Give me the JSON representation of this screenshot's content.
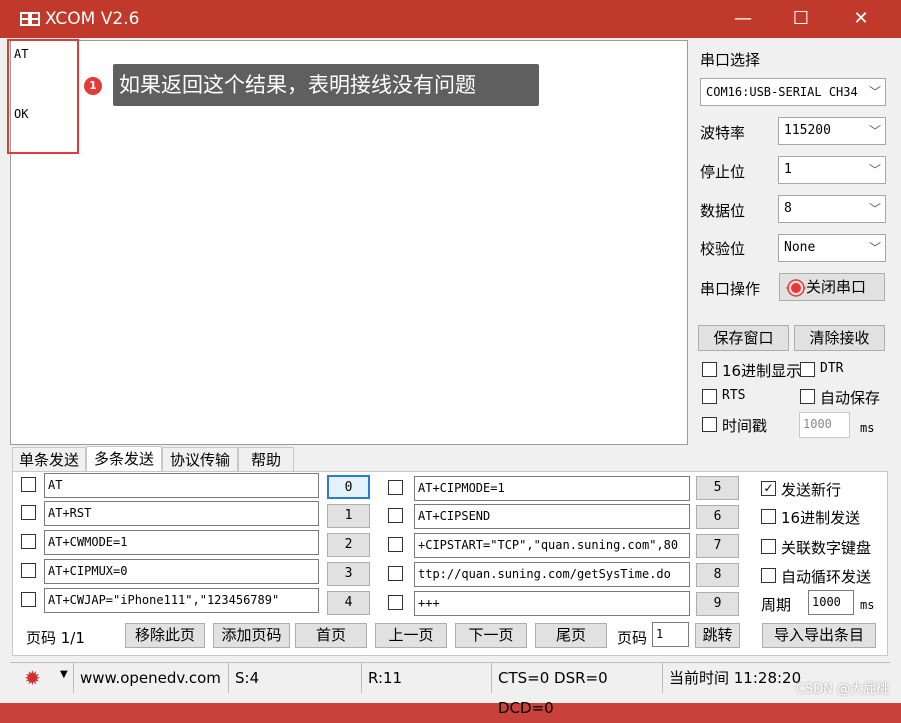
{
  "window": {
    "title": "XCOM V2.6",
    "minimize": "—",
    "maximize": "☐",
    "close": "✕"
  },
  "receive": {
    "line1": "AT",
    "line2": "OK"
  },
  "annotation": {
    "number": "1",
    "text": "如果返回这个结果，表明接线没有问题"
  },
  "serial": {
    "section_label": "串口选择",
    "port": "COM16:USB-SERIAL CH34",
    "baud_label": "波特率",
    "baud": "115200",
    "stop_label": "停止位",
    "stop": "1",
    "data_label": "数据位",
    "data": "8",
    "parity_label": "校验位",
    "parity": "None",
    "op_label": "串口操作",
    "op_button": "关闭串口",
    "save_window": "保存窗口",
    "clear_recv": "清除接收",
    "hex_display": "16进制显示",
    "dtr": "DTR",
    "rts": "RTS",
    "auto_save": "自动保存",
    "timestamp": "时间戳",
    "timestamp_value": "1000",
    "ms": "ms"
  },
  "tabs": [
    "单条发送",
    "多条发送",
    "协议传输",
    "帮助"
  ],
  "multi_send": {
    "left": [
      {
        "text": "AT",
        "num": "0"
      },
      {
        "text": "AT+RST",
        "num": "1"
      },
      {
        "text": "AT+CWMODE=1",
        "num": "2"
      },
      {
        "text": "AT+CIPMUX=0",
        "num": "3"
      },
      {
        "text": "AT+CWJAP=\"iPhone111\",\"123456789\"",
        "num": "4"
      }
    ],
    "right": [
      {
        "text": "AT+CIPMODE=1",
        "num": "5"
      },
      {
        "text": "AT+CIPSEND",
        "num": "6"
      },
      {
        "text": "+CIPSTART=\"TCP\",\"quan.suning.com\",80",
        "num": "7"
      },
      {
        "text": "ttp://quan.suning.com/getSysTime.do",
        "num": "8"
      },
      {
        "text": "+++",
        "num": "9"
      }
    ],
    "options": {
      "newline": "发送新行",
      "hex_send": "16进制发送",
      "keypad": "关联数字键盘",
      "loop": "自动循环发送",
      "period_label": "周期",
      "period": "1000",
      "ms": "ms"
    },
    "page_label": "页码 1/1",
    "remove_page": "移除此页",
    "add_page": "添加页码",
    "first": "首页",
    "prev": "上一页",
    "next": "下一页",
    "last": "尾页",
    "goto_label": "页码",
    "goto_value": "1",
    "jump": "跳转",
    "import_export": "导入导出条目"
  },
  "status": {
    "url": "www.openedv.com",
    "sent": "S:4",
    "recv": "R:11",
    "lines": "CTS=0 DSR=0 DCD=0",
    "time": "当前时间 11:28:20"
  },
  "watermark": "CSDN @大屁桃",
  "colors": {
    "title_bar": "#c0392b",
    "highlight": "#e53935",
    "annotation_bg": "#5f5f5f"
  }
}
